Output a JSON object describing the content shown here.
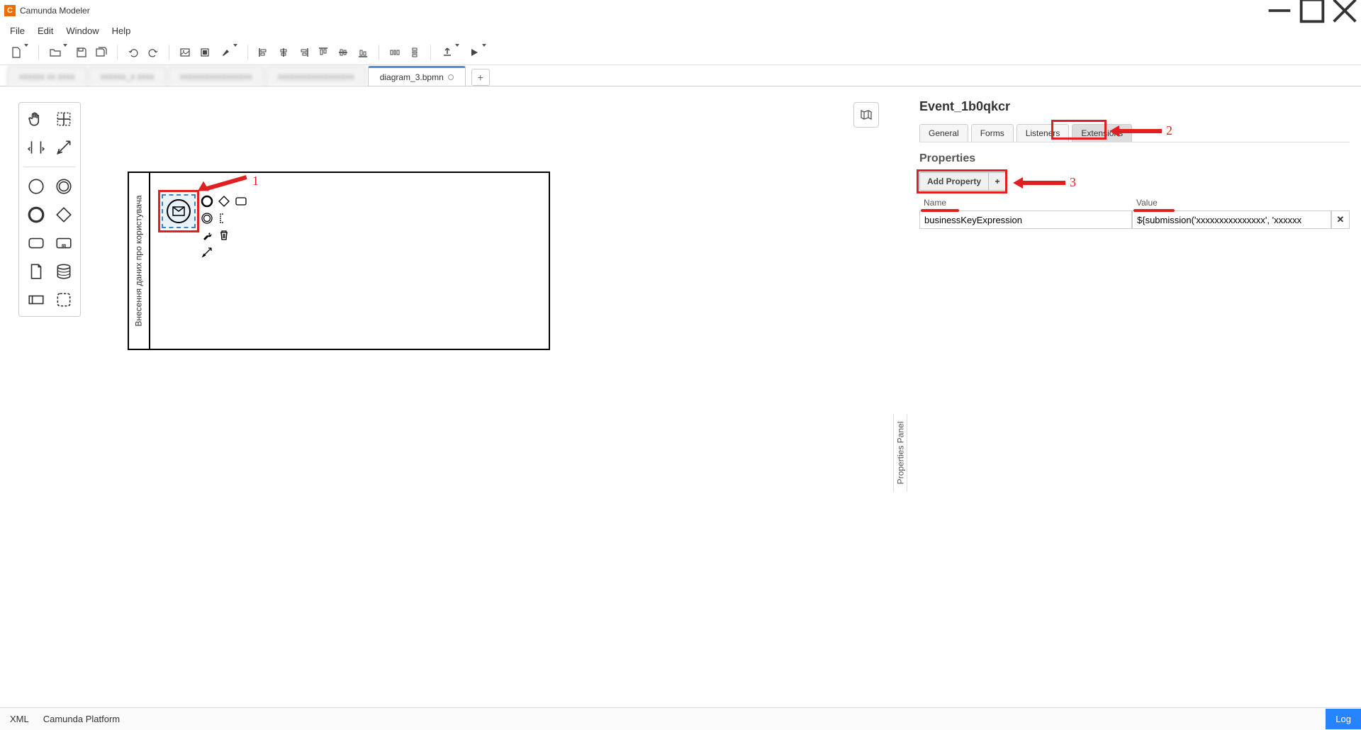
{
  "titlebar": {
    "app_title": "Camunda Modeler"
  },
  "menu": {
    "items": [
      "File",
      "Edit",
      "Window",
      "Help"
    ]
  },
  "toolbar": {
    "icons": [
      "new-file",
      "open-file",
      "save",
      "save-all",
      "undo",
      "redo",
      "image",
      "align-paint",
      "paint",
      "align-left",
      "align-center",
      "align-right",
      "dist-h",
      "dist-v",
      "align-v",
      "dist-vspread",
      "overview",
      "run-config",
      "deploy",
      "play"
    ]
  },
  "tabs": {
    "blurred": [
      "xxxxxx xx xxxx",
      "xxxxxx_x xxxx",
      "xxxxxxxxxxxxxxxxx",
      "xxxxxxxxxxxxxxxxxx"
    ],
    "active": "diagram_3.bpmn"
  },
  "canvas": {
    "lane_label": "Внесення даних про користувача",
    "minimap": "map"
  },
  "properties": {
    "panel_label": "Properties Panel",
    "element_id": "Event_1b0qkcr",
    "tabs": [
      "General",
      "Forms",
      "Listeners",
      "Extensions"
    ],
    "active_tab": 3,
    "section_title": "Properties",
    "add_button": "Add Property",
    "headers": {
      "name": "Name",
      "value": "Value"
    },
    "rows": [
      {
        "name": "businessKeyExpression",
        "value": "${submission('ххххххххххххххх', 'хххххх"
      }
    ]
  },
  "callouts": {
    "one": "1",
    "two": "2",
    "three": "3"
  },
  "status": {
    "left": [
      "XML",
      "Camunda Platform"
    ],
    "log": "Log"
  }
}
